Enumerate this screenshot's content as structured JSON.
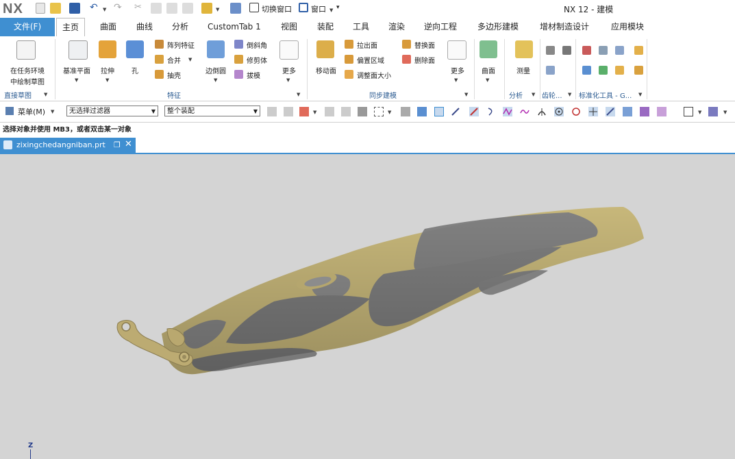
{
  "title_bar": {
    "logo": "NX",
    "app_title": "NX 12 - 建模",
    "switch_window": "切换窗口",
    "window_menu": "窗口"
  },
  "tabs": [
    {
      "label": "文件(F)"
    },
    {
      "label": "主页"
    },
    {
      "label": "曲面"
    },
    {
      "label": "曲线"
    },
    {
      "label": "分析"
    },
    {
      "label": "CustomTab 1"
    },
    {
      "label": "视图"
    },
    {
      "label": "装配"
    },
    {
      "label": "工具"
    },
    {
      "label": "渲染"
    },
    {
      "label": "逆向工程"
    },
    {
      "label": "多边形建模"
    },
    {
      "label": "增材制造设计"
    },
    {
      "label": "应用模块"
    }
  ],
  "ribbon": {
    "direct_sketch": {
      "line1": "在任务环境",
      "line2": "中绘制草图",
      "group": "直接草图"
    },
    "feature": {
      "datum_plane": "基准平面",
      "extrude": "拉伸",
      "hole": "孔",
      "pattern_feature": "阵列特征",
      "unite": "合并",
      "shell": "抽壳",
      "edge_blend": "边倒圆",
      "chamfer": "倒斜角",
      "trim_body": "修剪体",
      "draft": "拔模",
      "more": "更多",
      "group": "特征"
    },
    "sync": {
      "move_face": "移动面",
      "pull_face": "拉出面",
      "offset_region": "偏置区域",
      "resize_face": "调整面大小",
      "replace_face": "替换面",
      "delete_face": "删除面",
      "more": "更多",
      "group": "同步建模"
    },
    "surface": {
      "label": "曲面"
    },
    "analysis": {
      "measure": "测量",
      "group": "分析"
    },
    "gear": {
      "group": "齿轮..."
    },
    "standard": {
      "group": "标准化工具 - G..."
    }
  },
  "filter_bar": {
    "menu": "菜单(M)",
    "type_filter": "无选择过滤器",
    "scope": "整个装配"
  },
  "status": "选择对象并使用 MB3，或者双击某一对象",
  "document_tab": "zixingchedangniban.prt",
  "triad_axis": "Z",
  "colors": {
    "accent": "#3f8fd1",
    "viewport": "#d4d4d4",
    "part_gold": "#c7b77a",
    "part_gray": "#808080"
  }
}
